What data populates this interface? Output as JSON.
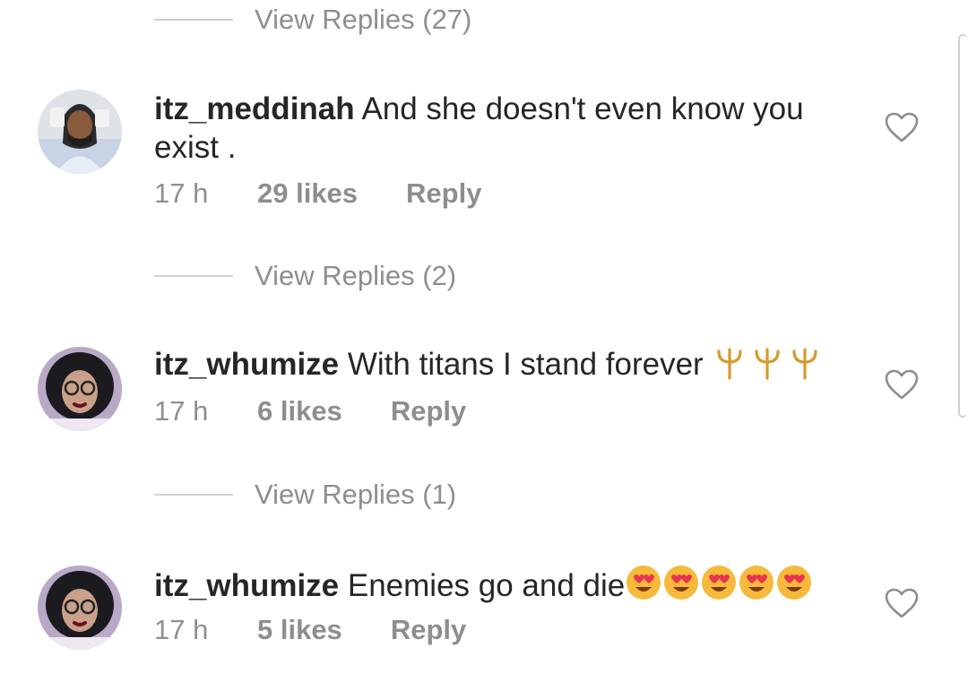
{
  "threads": [
    {
      "view_replies": "View Replies (27)"
    },
    {
      "username": "itz_meddinah",
      "text": "And she doesn't even know you exist .",
      "time": "17 h",
      "likes": "29 likes",
      "reply": "Reply",
      "view_replies": "View Replies (2)"
    },
    {
      "username": "itz_whumize",
      "text": "With titans I stand forever",
      "emoji": "🔱🔱🔱",
      "time": "17 h",
      "likes": "6 likes",
      "reply": "Reply",
      "view_replies": "View Replies (1)"
    },
    {
      "username": "itz_whumize",
      "text": "Enemies go and die",
      "emoji": "😍😍😍😍😍",
      "time": "17 h",
      "likes": "5 likes",
      "reply": "Reply"
    }
  ],
  "colors": {
    "text": "#262626",
    "muted": "#8e8e8e",
    "divider": "#cfcfcf"
  },
  "icons": {
    "like": "heart-outline-icon",
    "trident": "trident-emoji",
    "heart_eyes": "heart-eyes-emoji"
  }
}
